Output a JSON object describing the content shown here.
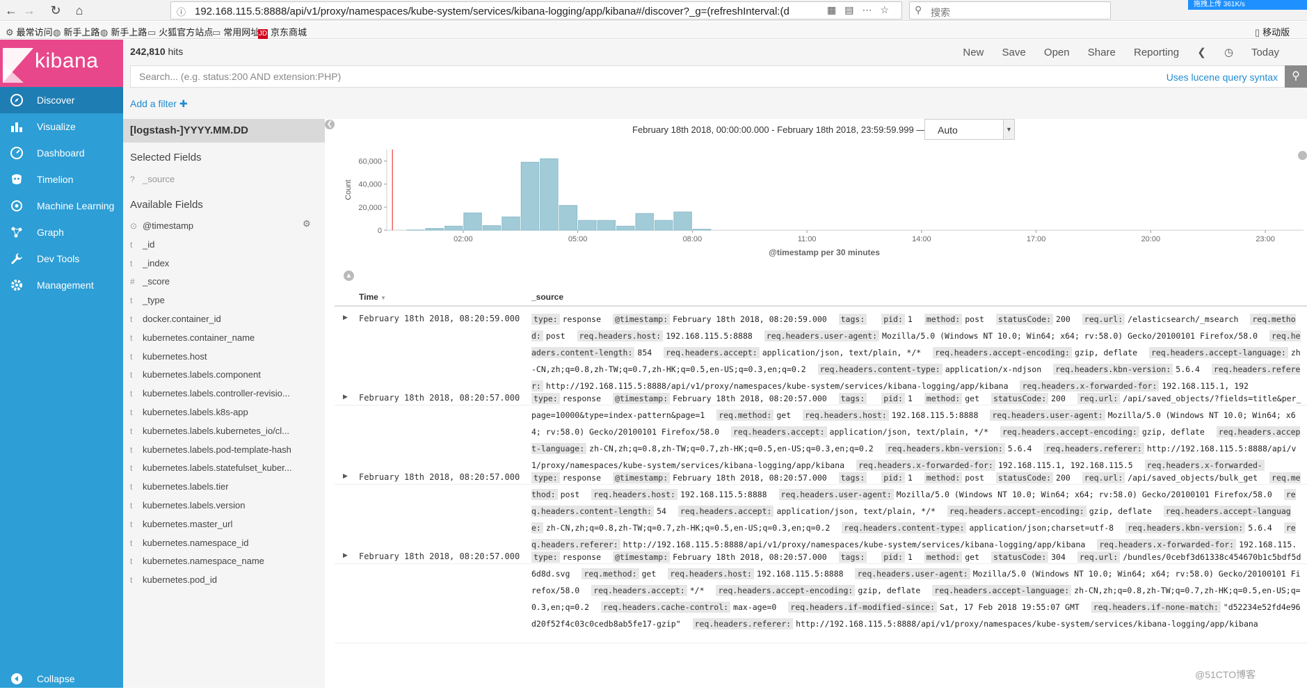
{
  "browser": {
    "url": "192.168.115.5:8888/api/v1/proxy/namespaces/kube-system/services/kibana-logging/app/kibana#/discover?_g=(refreshInterval:(d",
    "search_placeholder": "搜索",
    "speed_badge": "拖拽上传 361K/s",
    "bookmarks": [
      {
        "label": "最常访问",
        "icon": "gear-icon"
      },
      {
        "label": "新手上路",
        "icon": "globe-icon"
      },
      {
        "label": "新手上路",
        "icon": "globe-icon"
      },
      {
        "label": "火狐官方站点",
        "icon": "folder-icon"
      },
      {
        "label": "常用网址",
        "icon": "folder-icon"
      },
      {
        "label": "京东商城",
        "icon": "jd-icon"
      }
    ],
    "mobile_bookmark": "移动版"
  },
  "sidebar": {
    "logo": "kibana",
    "items": [
      {
        "label": "Discover",
        "icon": "compass-icon",
        "active": true
      },
      {
        "label": "Visualize",
        "icon": "bar-chart-icon",
        "active": false
      },
      {
        "label": "Dashboard",
        "icon": "dashboard-icon",
        "active": false
      },
      {
        "label": "Timelion",
        "icon": "timelion-icon",
        "active": false
      },
      {
        "label": "Machine Learning",
        "icon": "ml-icon",
        "active": false
      },
      {
        "label": "Graph",
        "icon": "graph-icon",
        "active": false
      },
      {
        "label": "Dev Tools",
        "icon": "wrench-icon",
        "active": false
      },
      {
        "label": "Management",
        "icon": "gear-icon",
        "active": false
      }
    ],
    "collapse": "Collapse"
  },
  "topbar": {
    "hits_count": "242,810",
    "hits_label": "hits",
    "menu": [
      "New",
      "Save",
      "Open",
      "Share",
      "Reporting"
    ],
    "time_label": "Today"
  },
  "search": {
    "placeholder": "Search... (e.g. status:200 AND extension:PHP)",
    "lucene": "Uses lucene query syntax"
  },
  "filter": {
    "add_label": "Add a filter"
  },
  "fields": {
    "index_pattern": "[logstash-]YYYY.MM.DD",
    "selected_title": "Selected Fields",
    "selected": [
      {
        "type": "?",
        "name": "_source"
      }
    ],
    "available_title": "Available Fields",
    "available": [
      {
        "type": "⊙",
        "name": "@timestamp"
      },
      {
        "type": "t",
        "name": "_id"
      },
      {
        "type": "t",
        "name": "_index"
      },
      {
        "type": "#",
        "name": "_score"
      },
      {
        "type": "t",
        "name": "_type"
      },
      {
        "type": "t",
        "name": "docker.container_id"
      },
      {
        "type": "t",
        "name": "kubernetes.container_name"
      },
      {
        "type": "t",
        "name": "kubernetes.host"
      },
      {
        "type": "t",
        "name": "kubernetes.labels.component"
      },
      {
        "type": "t",
        "name": "kubernetes.labels.controller-revisio..."
      },
      {
        "type": "t",
        "name": "kubernetes.labels.k8s-app"
      },
      {
        "type": "t",
        "name": "kubernetes.labels.kubernetes_io/cl..."
      },
      {
        "type": "t",
        "name": "kubernetes.labels.pod-template-hash"
      },
      {
        "type": "t",
        "name": "kubernetes.labels.statefulset_kuber..."
      },
      {
        "type": "t",
        "name": "kubernetes.labels.tier"
      },
      {
        "type": "t",
        "name": "kubernetes.labels.version"
      },
      {
        "type": "t",
        "name": "kubernetes.master_url"
      },
      {
        "type": "t",
        "name": "kubernetes.namespace_id"
      },
      {
        "type": "t",
        "name": "kubernetes.namespace_name"
      },
      {
        "type": "t",
        "name": "kubernetes.pod_id"
      }
    ]
  },
  "histogram": {
    "time_range": "February 18th 2018, 00:00:00.000 - February 18th 2018, 23:59:59.999 —",
    "interval": "Auto"
  },
  "chart_data": {
    "type": "bar",
    "ylabel": "Count",
    "xlabel": "@timestamp per 30 minutes",
    "ylim": [
      0,
      70000
    ],
    "yticks": [
      0,
      20000,
      40000,
      60000
    ],
    "ytick_labels": [
      "0",
      "20,000",
      "40,000",
      "60,000"
    ],
    "xticks_hours": [
      2,
      5,
      8,
      11,
      14,
      17,
      20,
      23
    ],
    "xtick_labels": [
      "02:00",
      "05:00",
      "08:00",
      "11:00",
      "14:00",
      "17:00",
      "20:00",
      "23:00"
    ],
    "xlim_hours": [
      0,
      24
    ],
    "marker_hour": 0.15,
    "bin_hours": 0.5,
    "x_hours": [
      0.5,
      1.0,
      1.5,
      2.0,
      2.5,
      3.0,
      3.5,
      4.0,
      4.5,
      5.0,
      5.5,
      6.0,
      6.5,
      7.0,
      7.5,
      8.0
    ],
    "values": [
      200,
      1500,
      3500,
      15000,
      4000,
      11500,
      59000,
      62000,
      21500,
      8500,
      8500,
      3500,
      14500,
      8500,
      15800,
      800
    ]
  },
  "table": {
    "time_header": "Time",
    "source_header": "_source",
    "rows": [
      {
        "time": "February 18th 2018, 08:20:59.000",
        "source": [
          [
            "type:",
            "response"
          ],
          [
            "@timestamp:",
            "February 18th 2018, 08:20:59.000"
          ],
          [
            "tags:",
            ""
          ],
          [
            "pid:",
            "1"
          ],
          [
            "method:",
            "post"
          ],
          [
            "statusCode:",
            "200"
          ],
          [
            "req.url:",
            "/elasticsearch/_msearch"
          ],
          [
            "req.method:",
            "post"
          ],
          [
            "req.headers.host:",
            "192.168.115.5:8888"
          ],
          [
            "req.headers.user-agent:",
            "Mozilla/5.0 (Windows NT 10.0; Win64; x64; rv:58.0) Gecko/20100101 Firefox/58.0"
          ],
          [
            "req.headers.content-length:",
            "854"
          ],
          [
            "req.headers.accept:",
            "application/json, text/plain, */*"
          ],
          [
            "req.headers.accept-encoding:",
            "gzip, deflate"
          ],
          [
            "req.headers.accept-language:",
            "zh-CN,zh;q=0.8,zh-TW;q=0.7,zh-HK;q=0.5,en-US;q=0.3,en;q=0.2"
          ],
          [
            "req.headers.content-type:",
            "application/x-ndjson"
          ],
          [
            "req.headers.kbn-version:",
            "5.6.4"
          ],
          [
            "req.headers.referer:",
            "http://192.168.115.5:8888/api/v1/proxy/namespaces/kube-system/services/kibana-logging/app/kibana"
          ],
          [
            "req.headers.x-forwarded-for:",
            "192.168.115.1, 192"
          ]
        ]
      },
      {
        "time": "February 18th 2018, 08:20:57.000",
        "source": [
          [
            "type:",
            "response"
          ],
          [
            "@timestamp:",
            "February 18th 2018, 08:20:57.000"
          ],
          [
            "tags:",
            ""
          ],
          [
            "pid:",
            "1"
          ],
          [
            "method:",
            "get"
          ],
          [
            "statusCode:",
            "200"
          ],
          [
            "req.url:",
            "/api/saved_objects/?fields=title&per_page=10000&type=index-pattern&page=1"
          ],
          [
            "req.method:",
            "get"
          ],
          [
            "req.headers.host:",
            "192.168.115.5:8888"
          ],
          [
            "req.headers.user-agent:",
            "Mozilla/5.0 (Windows NT 10.0; Win64; x64; rv:58.0) Gecko/20100101 Firefox/58.0"
          ],
          [
            "req.headers.accept:",
            "application/json, text/plain, */*"
          ],
          [
            "req.headers.accept-encoding:",
            "gzip, deflate"
          ],
          [
            "req.headers.accept-language:",
            "zh-CN,zh;q=0.8,zh-TW;q=0.7,zh-HK;q=0.5,en-US;q=0.3,en;q=0.2"
          ],
          [
            "req.headers.kbn-version:",
            "5.6.4"
          ],
          [
            "req.headers.referer:",
            "http://192.168.115.5:8888/api/v1/proxy/namespaces/kube-system/services/kibana-logging/app/kibana"
          ],
          [
            "req.headers.x-forwarded-for:",
            "192.168.115.1, 192.168.115.5"
          ],
          [
            "req.headers.x-forwarded-",
            ""
          ]
        ]
      },
      {
        "time": "February 18th 2018, 08:20:57.000",
        "source": [
          [
            "type:",
            "response"
          ],
          [
            "@timestamp:",
            "February 18th 2018, 08:20:57.000"
          ],
          [
            "tags:",
            ""
          ],
          [
            "pid:",
            "1"
          ],
          [
            "method:",
            "post"
          ],
          [
            "statusCode:",
            "200"
          ],
          [
            "req.url:",
            "/api/saved_objects/bulk_get"
          ],
          [
            "req.method:",
            "post"
          ],
          [
            "req.headers.host:",
            "192.168.115.5:8888"
          ],
          [
            "req.headers.user-agent:",
            "Mozilla/5.0 (Windows NT 10.0; Win64; x64; rv:58.0) Gecko/20100101 Firefox/58.0"
          ],
          [
            "req.headers.content-length:",
            "54"
          ],
          [
            "req.headers.accept:",
            "application/json, text/plain, */*"
          ],
          [
            "req.headers.accept-encoding:",
            "gzip, deflate"
          ],
          [
            "req.headers.accept-language:",
            "zh-CN,zh;q=0.8,zh-TW;q=0.7,zh-HK;q=0.5,en-US;q=0.3,en;q=0.2"
          ],
          [
            "req.headers.content-type:",
            "application/json;charset=utf-8"
          ],
          [
            "req.headers.kbn-version:",
            "5.6.4"
          ],
          [
            "req.headers.referer:",
            "http://192.168.115.5:8888/api/v1/proxy/namespaces/kube-system/services/kibana-logging/app/kibana"
          ],
          [
            "req.headers.x-forwarded-for:",
            "192.168.115.1, 192.16"
          ]
        ]
      },
      {
        "time": "February 18th 2018, 08:20:57.000",
        "source": [
          [
            "type:",
            "response"
          ],
          [
            "@timestamp:",
            "February 18th 2018, 08:20:57.000"
          ],
          [
            "tags:",
            ""
          ],
          [
            "pid:",
            "1"
          ],
          [
            "method:",
            "get"
          ],
          [
            "statusCode:",
            "304"
          ],
          [
            "req.url:",
            "/bundles/0cebf3d61338c454670b1c5bdf5d6d8d.svg"
          ],
          [
            "req.method:",
            "get"
          ],
          [
            "req.headers.host:",
            "192.168.115.5:8888"
          ],
          [
            "req.headers.user-agent:",
            "Mozilla/5.0 (Windows NT 10.0; Win64; x64; rv:58.0) Gecko/20100101 Firefox/58.0"
          ],
          [
            "req.headers.accept:",
            "*/*"
          ],
          [
            "req.headers.accept-encoding:",
            "gzip, deflate"
          ],
          [
            "req.headers.accept-language:",
            "zh-CN,zh;q=0.8,zh-TW;q=0.7,zh-HK;q=0.5,en-US;q=0.3,en;q=0.2"
          ],
          [
            "req.headers.cache-control:",
            "max-age=0"
          ],
          [
            "req.headers.if-modified-since:",
            "Sat, 17 Feb 2018 19:55:07 GMT"
          ],
          [
            "req.headers.if-none-match:",
            "\"d52234e52fd4e96d20f52f4c03c0cedb8ab5fe17-gzip\""
          ],
          [
            "req.headers.referer:",
            "http://192.168.115.5:8888/api/v1/proxy/namespaces/kube-system/services/kibana-logging/app/kibana"
          ]
        ]
      }
    ]
  },
  "watermark": "@51CTO博客"
}
